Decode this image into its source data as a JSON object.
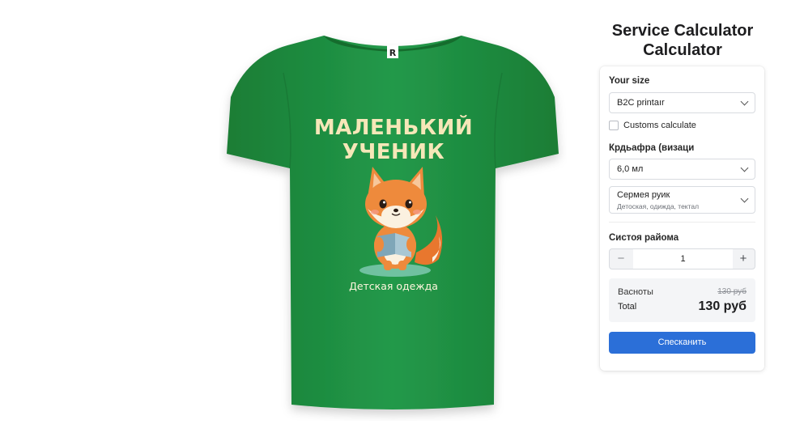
{
  "product": {
    "print_title_line1": "МАЛЕНЬКИЙ",
    "print_title_line2": "УЧЕНИК",
    "print_caption": "Детская одежда",
    "shirt_color": "#1f8f3d"
  },
  "calculator": {
    "title_line1": "Service Calculator",
    "title_line2": "Calculator",
    "size_label": "Your size",
    "size_value": "B2C printaır",
    "customs_label": "Customs calculate",
    "customs_checked": false,
    "option_label": "Крдьафра (визаци",
    "option_value": "6,0 мл",
    "category_value": "Сермея руик",
    "category_sub": "Детоская, одижда, тектал",
    "quantity_label": "Систоя райома",
    "quantity_value": "1",
    "minus_symbol": "−",
    "plus_symbol": "+",
    "subtotal_label": "Васноты",
    "subtotal_old": "130 руб",
    "total_label": "Total",
    "total_value": "130 руб",
    "cta_label": "Спесканить",
    "accent_color": "#2b6fd8"
  }
}
